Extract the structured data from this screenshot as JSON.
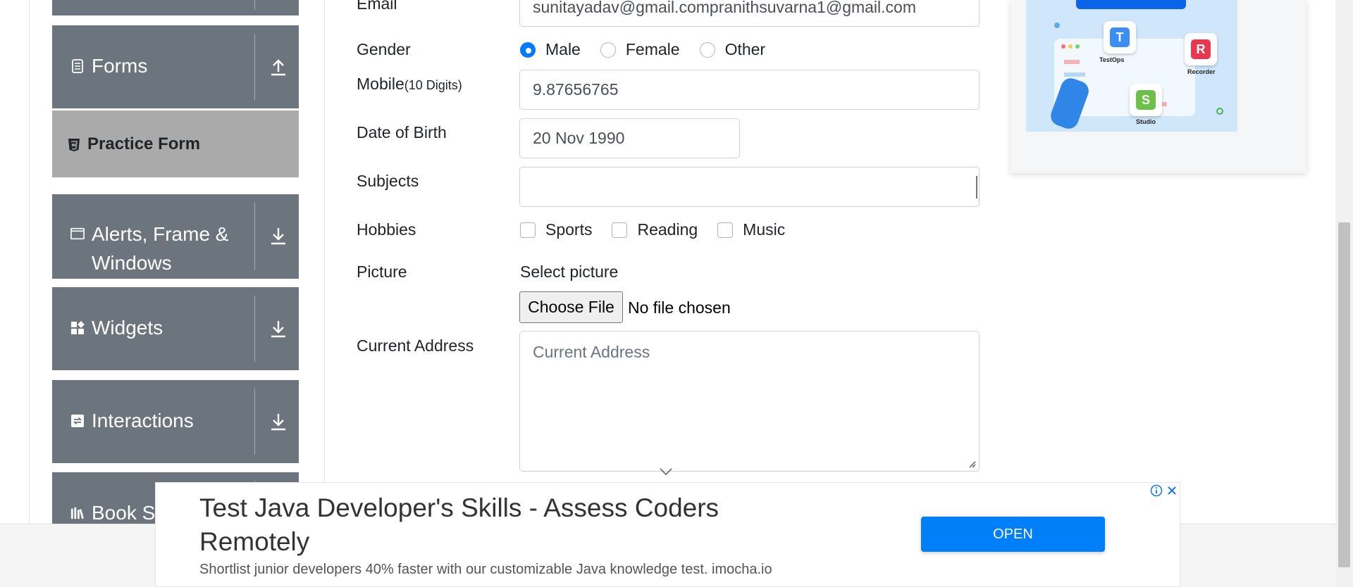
{
  "sidebar": {
    "groups": [
      {
        "label": "Forms",
        "icon": "document-icon",
        "arrow": "upload-arrow-icon"
      },
      {
        "label_line1": "Alerts, Frame &",
        "label_line2": "Windows",
        "icon": "window-icon",
        "arrow": "download-arrow-icon"
      },
      {
        "label": "Widgets",
        "icon": "widgets-icon",
        "arrow": "download-arrow-icon"
      },
      {
        "label": "Interactions",
        "icon": "interactions-icon",
        "arrow": "download-arrow-icon"
      },
      {
        "label": "Book St",
        "icon": "books-icon",
        "arrow": "download-arrow-icon"
      }
    ],
    "active_item": {
      "label": "Practice Form",
      "icon": "html5-icon"
    }
  },
  "form": {
    "email_label": "Email",
    "email_value": "sunitayadav@gmail.compranithsuvarna1@gmail.com",
    "gender_label": "Gender",
    "gender_options": [
      "Male",
      "Female",
      "Other"
    ],
    "gender_selected": "Male",
    "mobile_label": "Mobile",
    "mobile_hint": "(10 Digits)",
    "mobile_value": "9.87656765",
    "dob_label": "Date of Birth",
    "dob_value": "20 Nov 1990",
    "subjects_label": "Subjects",
    "subjects_value": "",
    "hobbies_label": "Hobbies",
    "hobbies": [
      "Sports",
      "Reading",
      "Music"
    ],
    "picture_label": "Picture",
    "picture_prompt": "Select picture",
    "file_button": "Choose File",
    "file_status": "No file chosen",
    "address_label": "Current Address",
    "address_placeholder": "Current Address"
  },
  "ad_card": {
    "badges": [
      "TestOps",
      "Recorder",
      "Studio"
    ]
  },
  "bottom_ad": {
    "title": "Test Java Developer's Skills - Assess Coders Remotely",
    "description": "Shortlist junior developers 40% faster with our customizable Java knowledge test. imocha.io",
    "button": "OPEN"
  },
  "colors": {
    "sidebar_group": "#6c757d",
    "sidebar_active": "#aaaaaa",
    "primary": "#007bff",
    "ad_button": "#007ff8"
  }
}
